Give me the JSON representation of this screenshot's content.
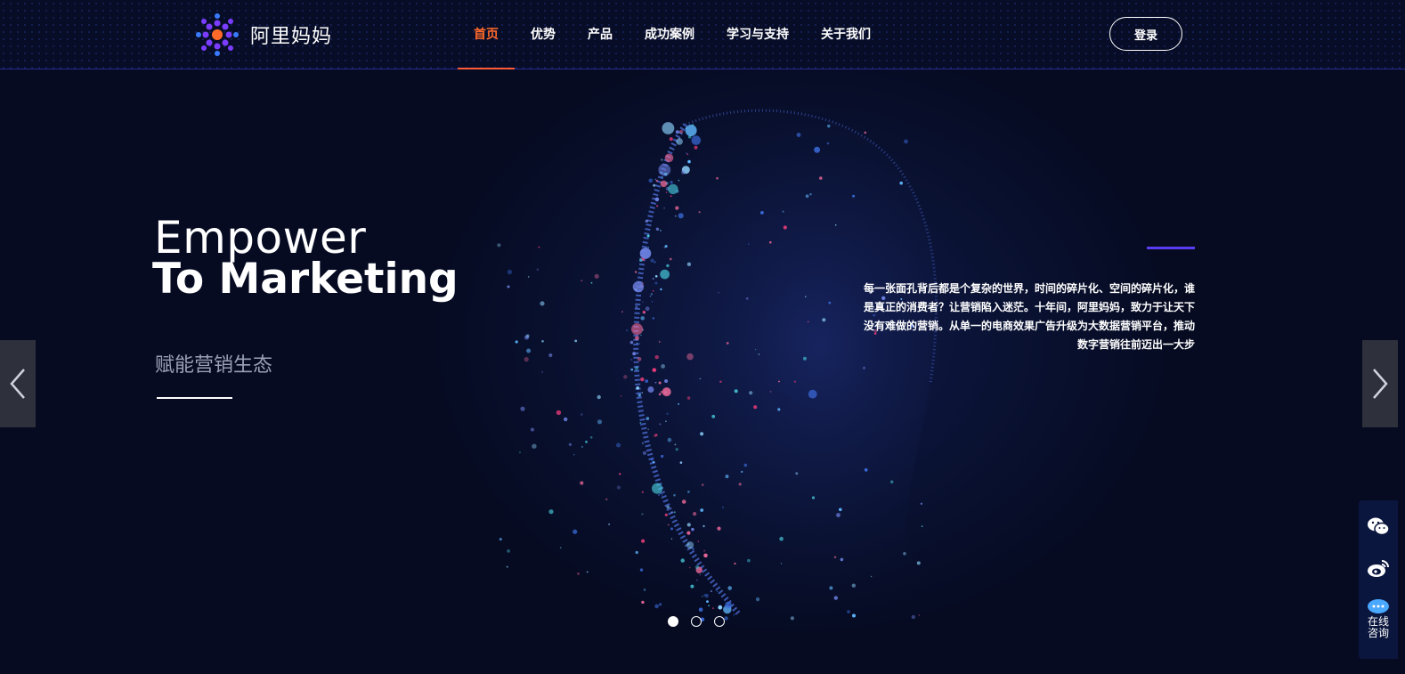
{
  "header": {
    "logo_text": "阿里妈妈",
    "nav": [
      {
        "label": "首页",
        "active": true
      },
      {
        "label": "优势",
        "active": false
      },
      {
        "label": "产品",
        "active": false
      },
      {
        "label": "成功案例",
        "active": false
      },
      {
        "label": "学习与支持",
        "active": false
      },
      {
        "label": "关于我们",
        "active": false
      }
    ],
    "login_label": "登录"
  },
  "hero": {
    "title_line1": "Empower",
    "title_line2": "To Marketing",
    "subtitle": "赋能营销生态",
    "description": "每一张面孔背后都是个复杂的世界，时间的碎片化、空间的碎片化，谁是真正的消费者？让营销陷入迷茫。十年间，阿里妈妈，致力于让天下没有难做的营销。从单一的电商效果广告升级为大数据营销平台，推动数字营销往前迈出一大步"
  },
  "carousel": {
    "slide_count": 3,
    "active_index": 0
  },
  "sidebar": {
    "items": [
      {
        "icon": "wechat-icon"
      },
      {
        "icon": "weibo-icon"
      },
      {
        "icon": "chat-icon",
        "label": "在线咨询"
      }
    ]
  },
  "colors": {
    "background": "#060b22",
    "nav_active": "#ff6a2b",
    "accent_purple": "#5a3df0",
    "sidebar_bg": "#0b163e"
  }
}
